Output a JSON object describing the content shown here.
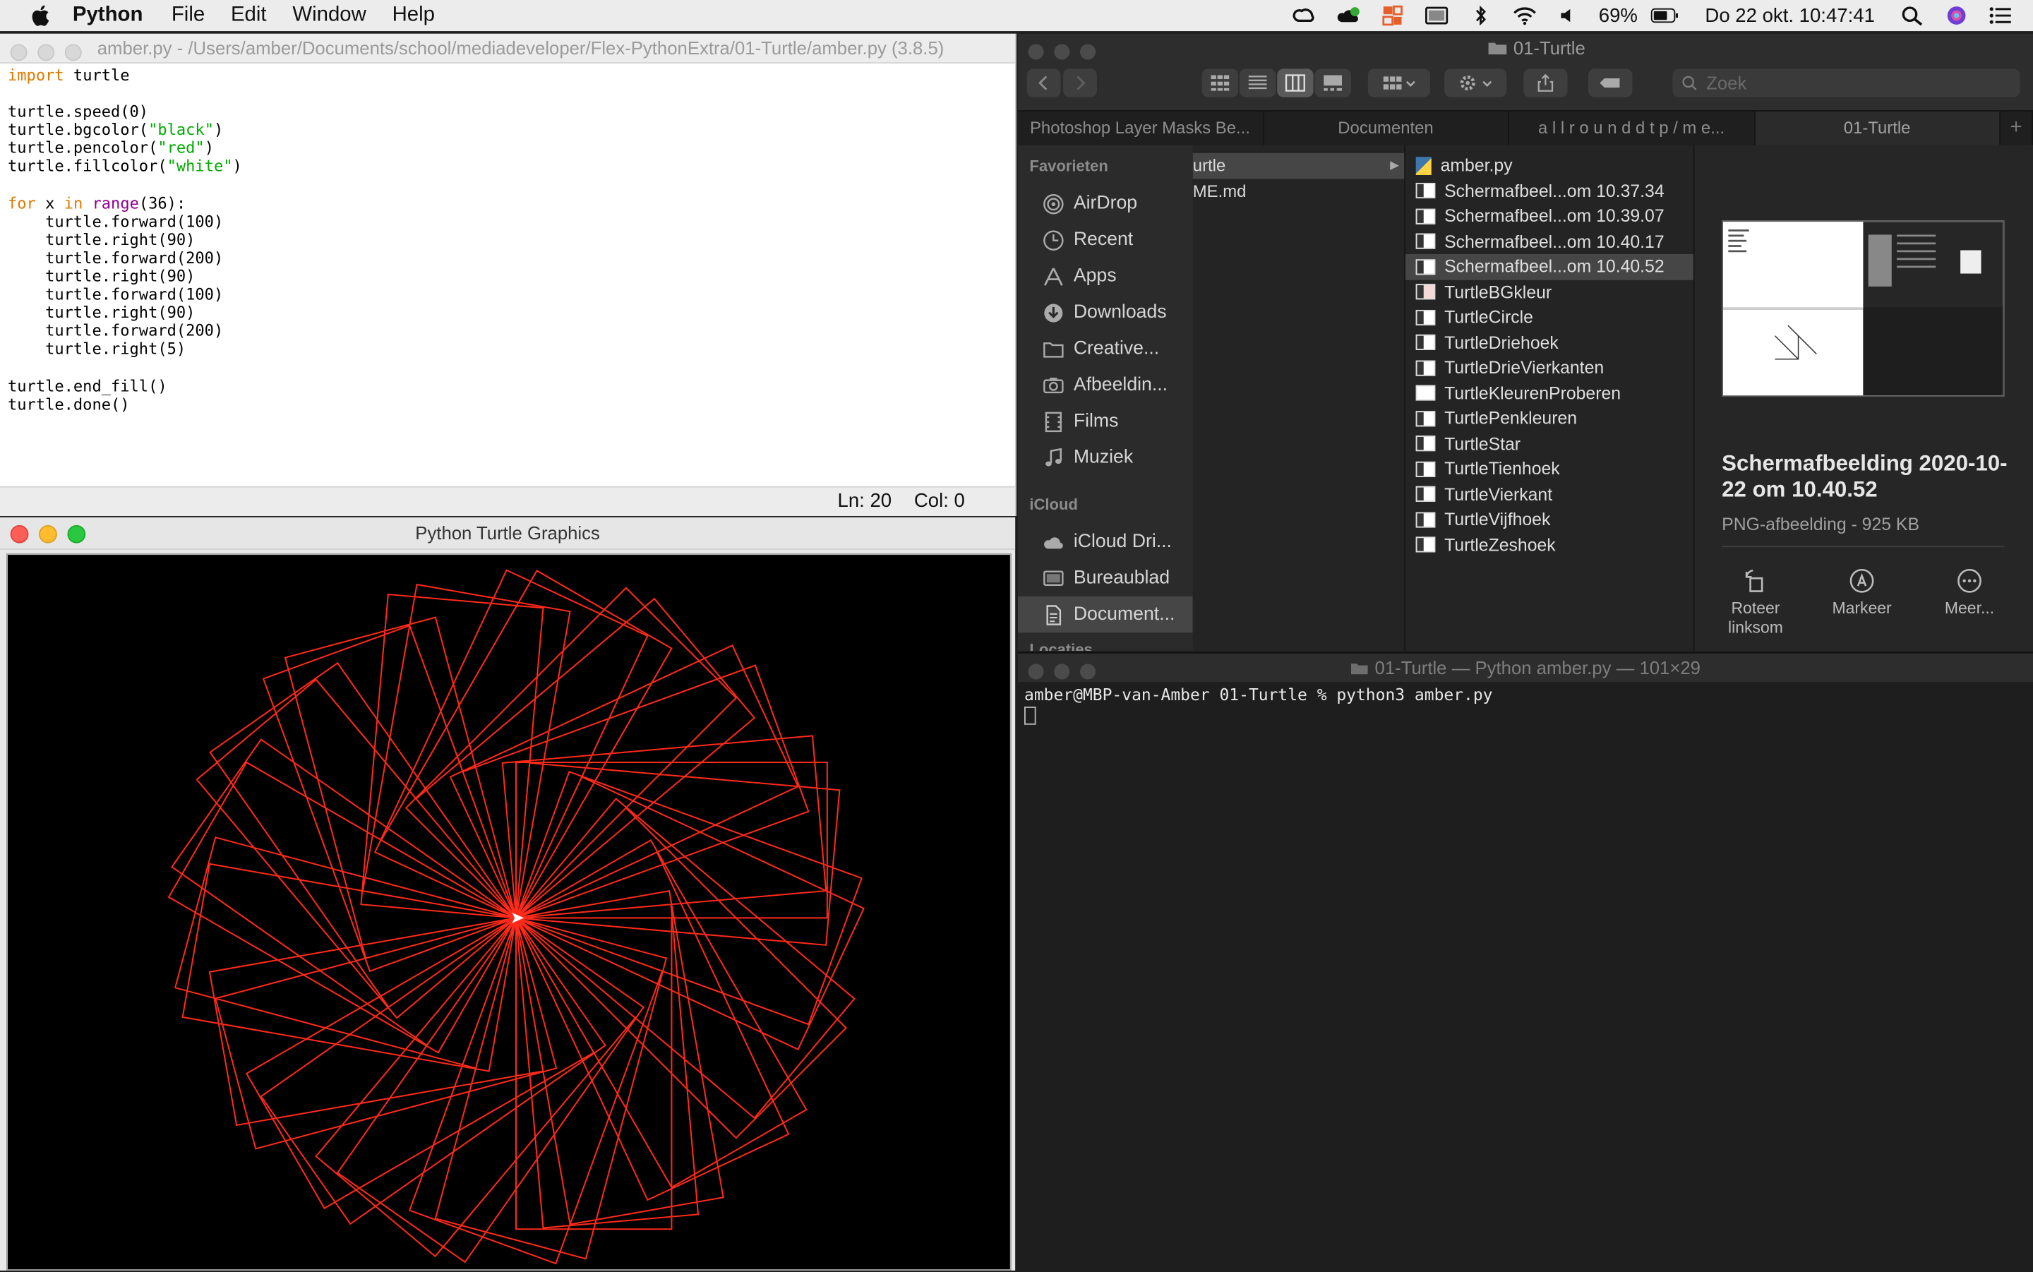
{
  "menubar": {
    "app_name": "Python",
    "menus": [
      "File",
      "Edit",
      "Window",
      "Help"
    ],
    "battery_percent": "69%",
    "clock": "Do 22 okt.  10:47:41"
  },
  "editor": {
    "title": "amber.py - /Users/amber/Documents/school/mediadeveloper/Flex-PythonExtra/01-Turtle/amber.py (3.8.5)",
    "status_line": "Ln: 20",
    "status_col": "Col: 0",
    "code": {
      "l1_kw": "import",
      "l1_rest": " turtle",
      "l3": "turtle.speed(0)",
      "l4_a": "turtle.bgcolor(",
      "l4_s": "\"black\"",
      "l4_b": ")",
      "l5_a": "turtle.pencolor(",
      "l5_s": "\"red\"",
      "l5_b": ")",
      "l6_a": "turtle.fillcolor(",
      "l6_s": "\"white\"",
      "l6_b": ")",
      "l8_kw": "for",
      "l8_a": " x ",
      "l8_in": "in",
      "l8_sp": " ",
      "l8_fn": "range",
      "l8_b": "(36):",
      "loop": [
        "    turtle.forward(100)",
        "    turtle.right(90)",
        "    turtle.forward(200)",
        "    turtle.right(90)",
        "    turtle.forward(100)",
        "    turtle.right(90)",
        "    turtle.forward(200)",
        "    turtle.right(5)"
      ],
      "l18": "turtle.end_fill()",
      "l19": "turtle.done()"
    }
  },
  "turtle_window": {
    "title": "Python Turtle Graphics",
    "pen_color": "#ff2a1a",
    "bg_color": "#000000",
    "rectangles": 36,
    "side_a": 100,
    "side_b": 200,
    "turn_step_deg": 5
  },
  "finder": {
    "title": "01-Turtle",
    "search_placeholder": "Zoek",
    "tabs": [
      "Photoshop Layer Masks Be...",
      "Documenten",
      "a l l r o u n d  d t p / m e...",
      "01-Turtle"
    ],
    "sidebar": {
      "favorites_header": "Favorieten",
      "favorites": [
        {
          "label": "AirDrop",
          "icon": "airdrop-icon"
        },
        {
          "label": "Recent",
          "icon": "clock-icon"
        },
        {
          "label": "Apps",
          "icon": "apps-icon"
        },
        {
          "label": "Downloads",
          "icon": "download-icon"
        },
        {
          "label": "Creative...",
          "icon": "folder-icon"
        },
        {
          "label": "Afbeeldin...",
          "icon": "camera-icon"
        },
        {
          "label": "Films",
          "icon": "film-icon"
        },
        {
          "label": "Muziek",
          "icon": "music-icon"
        }
      ],
      "icloud_header": "iCloud",
      "icloud": [
        {
          "label": "iCloud Dri...",
          "icon": "cloud-icon"
        },
        {
          "label": "Bureaublad",
          "icon": "desktop-icon"
        },
        {
          "label": "Document...",
          "icon": "document-icon"
        }
      ],
      "next_header": "Locaties"
    },
    "column1": [
      "urtle",
      "ME.md"
    ],
    "files": [
      "amber.py",
      "Schermafbeel...om 10.37.34",
      "Schermafbeel...om 10.39.07",
      "Schermafbeel...om 10.40.17",
      "Schermafbeel...om 10.40.52",
      "TurtleBGkleur",
      "TurtleCircle",
      "TurtleDriehoek",
      "TurtleDrieVierkanten",
      "TurtleKleurenProberen",
      "TurtlePenkleuren",
      "TurtleStar",
      "TurtleTienhoek",
      "TurtleVierkant",
      "TurtleVijfhoek",
      "TurtleZeshoek"
    ],
    "preview": {
      "title": "Schermafbeelding 2020-10-22 om 10.40.52",
      "subtitle": "PNG-afbeelding - 925 KB",
      "actions": [
        "Roteer linksom",
        "Markeer",
        "Meer..."
      ]
    }
  },
  "terminal": {
    "title": "01-Turtle — Python amber.py — 101×29",
    "prompt": "amber@MBP-van-Amber 01-Turtle % python3 amber.py"
  }
}
